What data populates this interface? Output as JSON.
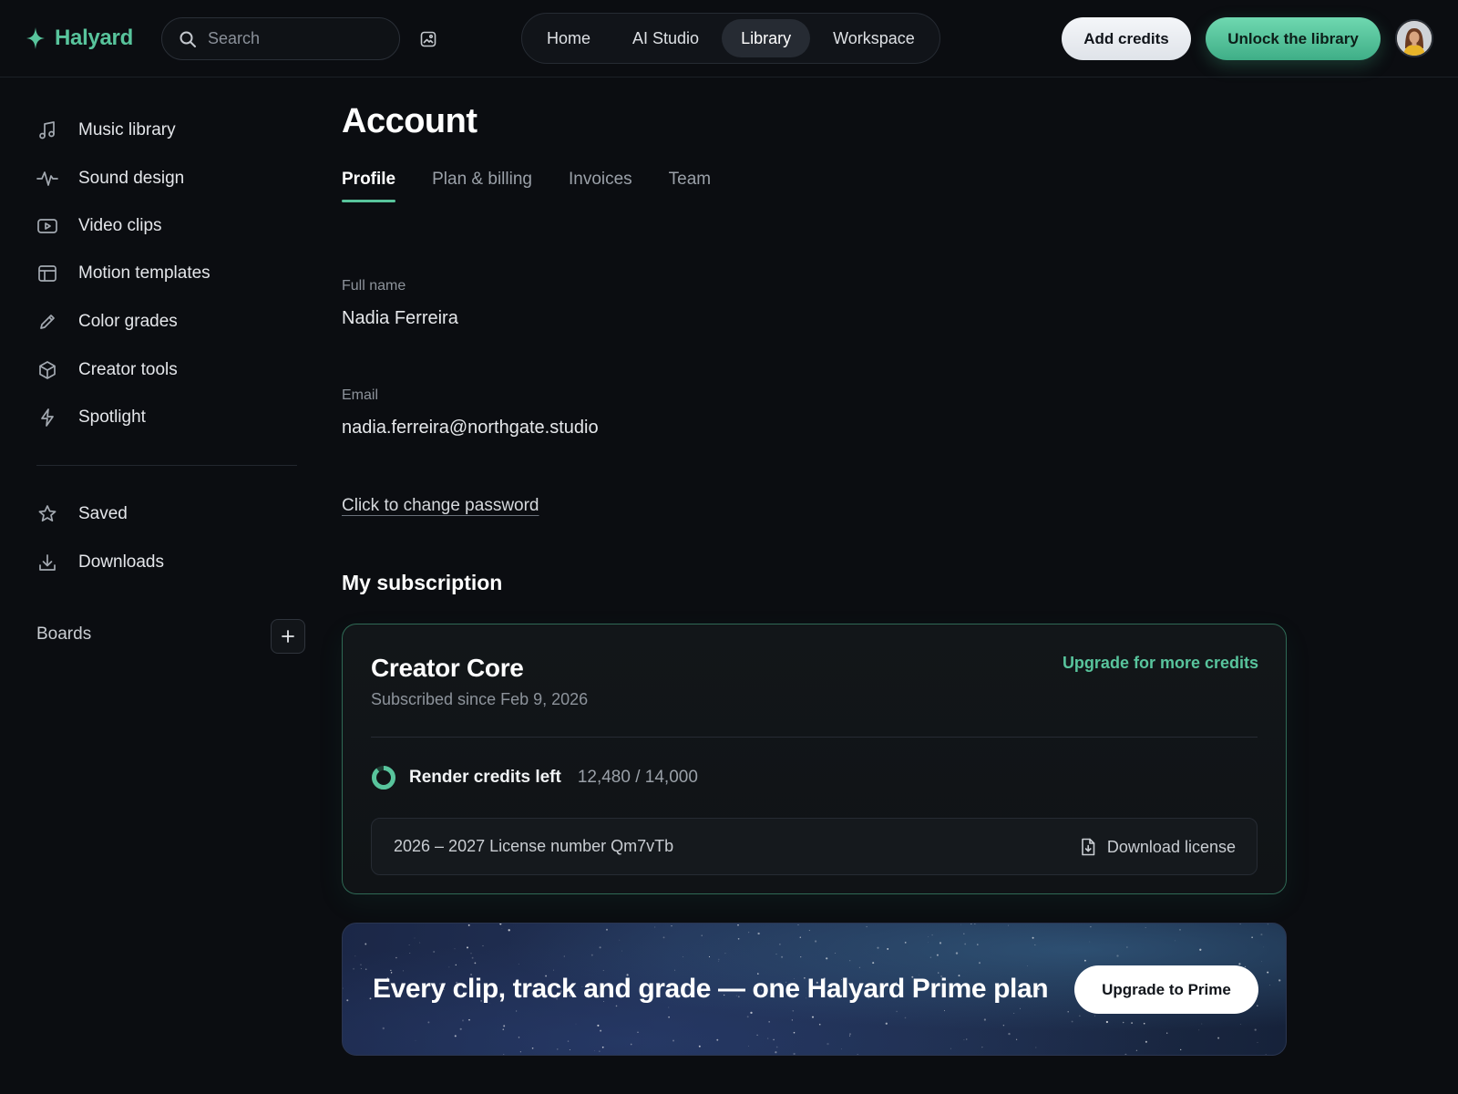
{
  "header": {
    "brand": "Halyard",
    "search_placeholder": "Search",
    "nav": [
      {
        "label": "Home",
        "active": false
      },
      {
        "label": "AI Studio",
        "active": false
      },
      {
        "label": "Library",
        "active": true
      },
      {
        "label": "Workspace",
        "active": false
      }
    ],
    "add_credits_label": "Add credits",
    "unlock_label": "Unlock the library"
  },
  "sidebar": {
    "items": [
      {
        "label": "Music library",
        "icon": "music-note-icon"
      },
      {
        "label": "Sound design",
        "icon": "waveform-icon"
      },
      {
        "label": "Video clips",
        "icon": "play-icon"
      },
      {
        "label": "Motion templates",
        "icon": "layout-icon"
      },
      {
        "label": "Color grades",
        "icon": "pencil-icon"
      },
      {
        "label": "Creator tools",
        "icon": "cube-icon"
      },
      {
        "label": "Spotlight",
        "icon": "lightning-icon"
      }
    ],
    "secondary": [
      {
        "label": "Saved",
        "icon": "star-icon"
      },
      {
        "label": "Downloads",
        "icon": "download-icon"
      }
    ],
    "boards_label": "Boards"
  },
  "main": {
    "title": "Account",
    "tabs": [
      {
        "label": "Profile",
        "active": true
      },
      {
        "label": "Plan & billing",
        "active": false
      },
      {
        "label": "Invoices",
        "active": false
      },
      {
        "label": "Team",
        "active": false
      }
    ],
    "full_name_label": "Full name",
    "full_name": "Nadia Ferreira",
    "email_label": "Email",
    "email": "nadia.ferreira@northgate.studio",
    "change_password": "Click to change password",
    "subscription_title": "My subscription"
  },
  "subscription": {
    "plan": "Creator Core",
    "since": "Subscribed since Feb 9, 2026",
    "upgrade_link": "Upgrade for more credits",
    "credits_label": "Render credits left",
    "credits_value": "12,480 / 14,000",
    "credits_fraction": 0.891,
    "license_text": "2026 – 2027 License number Qm7vTb",
    "download_label": "Download license"
  },
  "promo": {
    "text": "Every clip, track and grade — one Halyard Prime plan",
    "button": "Upgrade to Prime"
  },
  "colors": {
    "accent": "#58c49c",
    "background": "#0b0d11"
  }
}
